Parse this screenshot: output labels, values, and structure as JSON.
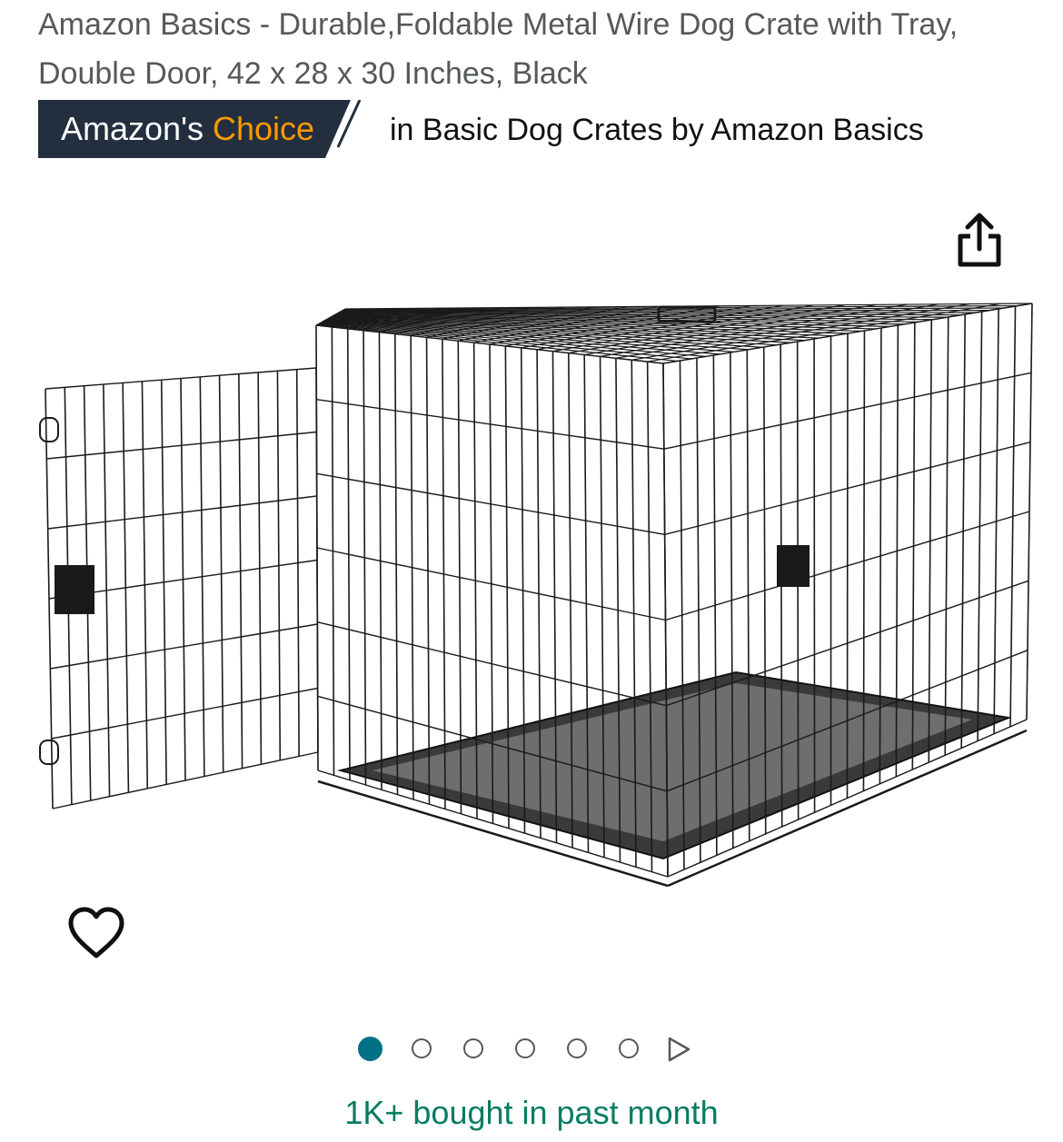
{
  "product": {
    "title": "Amazon Basics - Durable,Foldable Metal Wire Dog Crate with Tray, Double Door, 42 x 28 x 30 Inches, Black",
    "badge_prefix": "Amazon's ",
    "badge_choice": "Choice",
    "badge_category": "in Basic Dog Crates by Amazon Basics",
    "image_alt": "Black metal wire dog crate with plastic tray and open front door",
    "bought_text": "1K+ bought in past month"
  },
  "carousel": {
    "total_dots": 6,
    "active_index": 0
  },
  "icons": {
    "share": "share-icon",
    "wishlist": "heart-icon",
    "next": "play-triangle-icon"
  },
  "colors": {
    "badge_bg": "#232f3e",
    "choice_orange": "#ff9900",
    "active_dot": "#007185",
    "bought_green": "#067d62"
  }
}
